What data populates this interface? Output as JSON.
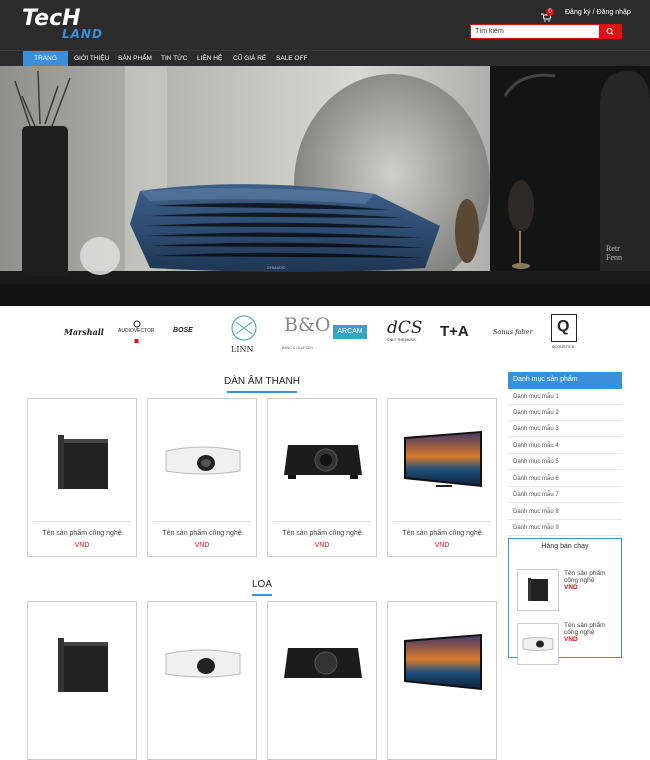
{
  "brand": {
    "logo_top": "TecH",
    "logo_bottom": "LAND"
  },
  "header": {
    "cart_count": "0",
    "auth_text": "Đăng ký / Đăng nhập",
    "search_placeholder": "Tìm kiếm"
  },
  "nav": {
    "items": [
      {
        "label": "Trang chủ",
        "active": true
      },
      {
        "label": "Giới thiệu"
      },
      {
        "label": "Sản phẩm"
      },
      {
        "label": "Tin tức"
      },
      {
        "label": "Liên hệ"
      },
      {
        "label": "Cũ giá rẻ"
      },
      {
        "label": "Sale off"
      }
    ]
  },
  "hero": {
    "speaker_text": "DYNAUDIO",
    "book_text_1": "Retr",
    "book_text_2": "Fenn"
  },
  "brands": {
    "marshall": "Marshall",
    "audiovector": "AUDIOVECTOR",
    "bose": "BOSE",
    "linn": "LINN",
    "bo": "B&O",
    "bo_sub": "BANG & OLUFSEN",
    "arcam": "ARCAM",
    "dcs": "dCS",
    "dcs_sub": "ONLY THE MUSIC",
    "ta": "T+A",
    "sonus": "Sonus faber",
    "q": "Q",
    "q_sub": "ACOUSTICS"
  },
  "sections": [
    {
      "title": "Dàn âm thanh"
    },
    {
      "title": "Loa"
    }
  ],
  "product": {
    "name": "Tên sản phẩm công nghệ",
    "price": "VND"
  },
  "sidebar": {
    "title": "Danh mục sản phẩm",
    "categories": [
      "Danh mục mẫu 1",
      "Danh mục mẫu 2",
      "Danh mục mẫu 3",
      "Danh mục mẫu 4",
      "Danh mục mẫu 5",
      "Danh mục mẫu 6",
      "Danh mục mẫu 7",
      "Danh mục mẫu 8",
      "Danh mục mẫu 9"
    ]
  },
  "bestsellers": {
    "title": "Hàng bán chạy",
    "items": [
      {
        "name": "Tên sản phẩm công nghệ",
        "price": "VND"
      },
      {
        "name": "Tên sản phẩm công nghệ",
        "price": "VND"
      }
    ]
  },
  "colors": {
    "accent": "#3b8fd8",
    "header_bg": "#2b2b2b",
    "price": "#dd1111"
  }
}
